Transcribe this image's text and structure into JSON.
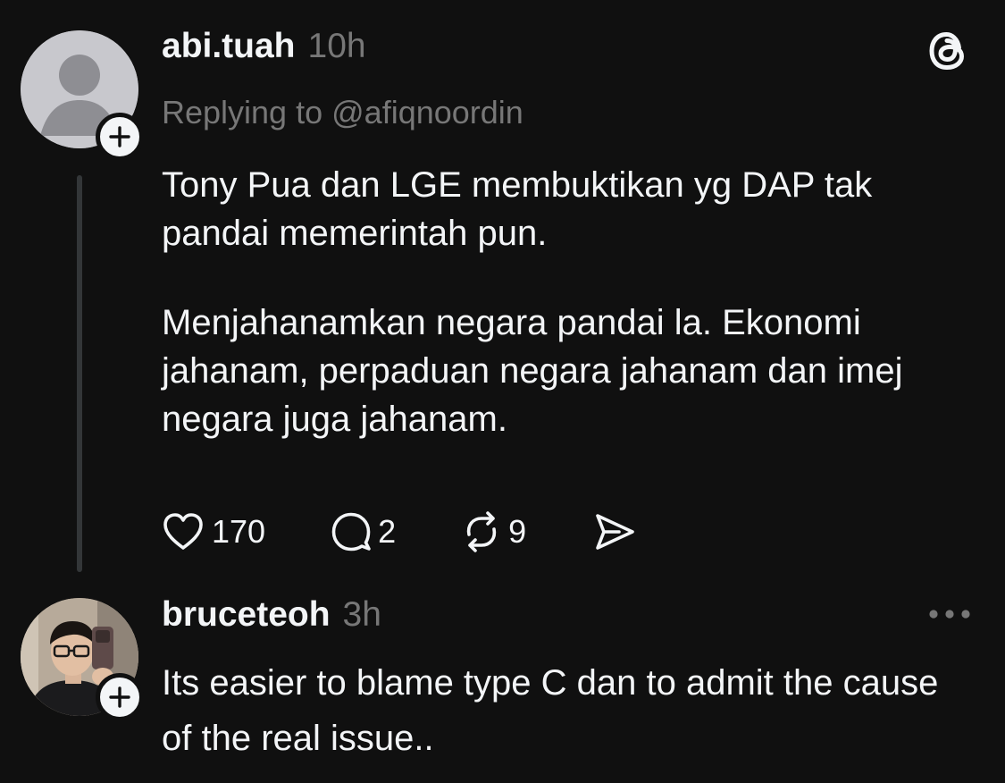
{
  "post": {
    "username": "abi.tuah",
    "time": "10h",
    "replying_label": "Replying to",
    "reply_handle": "@afiqnoordin",
    "paragraphs": [
      "Tony Pua dan LGE membuktikan yg DAP tak pandai memerintah pun.",
      "Menjahanamkan negara pandai la. Ekonomi jahanam, perpaduan negara jahanam dan imej negara juga jahanam."
    ],
    "actions": {
      "like_count": "170",
      "reply_count": "2",
      "repost_count": "9"
    }
  },
  "reply": {
    "username": "bruceteoh",
    "time": "3h",
    "text": "Its easier to blame type C dan to admit the cause of the real issue.."
  },
  "icons": {
    "app_logo": "threads-logo",
    "follow": "plus-icon",
    "like": "heart-icon",
    "reply": "comment-icon",
    "repost": "repost-icon",
    "share": "send-icon",
    "more": "more-icon"
  },
  "colors": {
    "background": "#101010",
    "primary_text": "#f3f5f7",
    "secondary_text": "#777777",
    "thread_line": "#333638"
  }
}
